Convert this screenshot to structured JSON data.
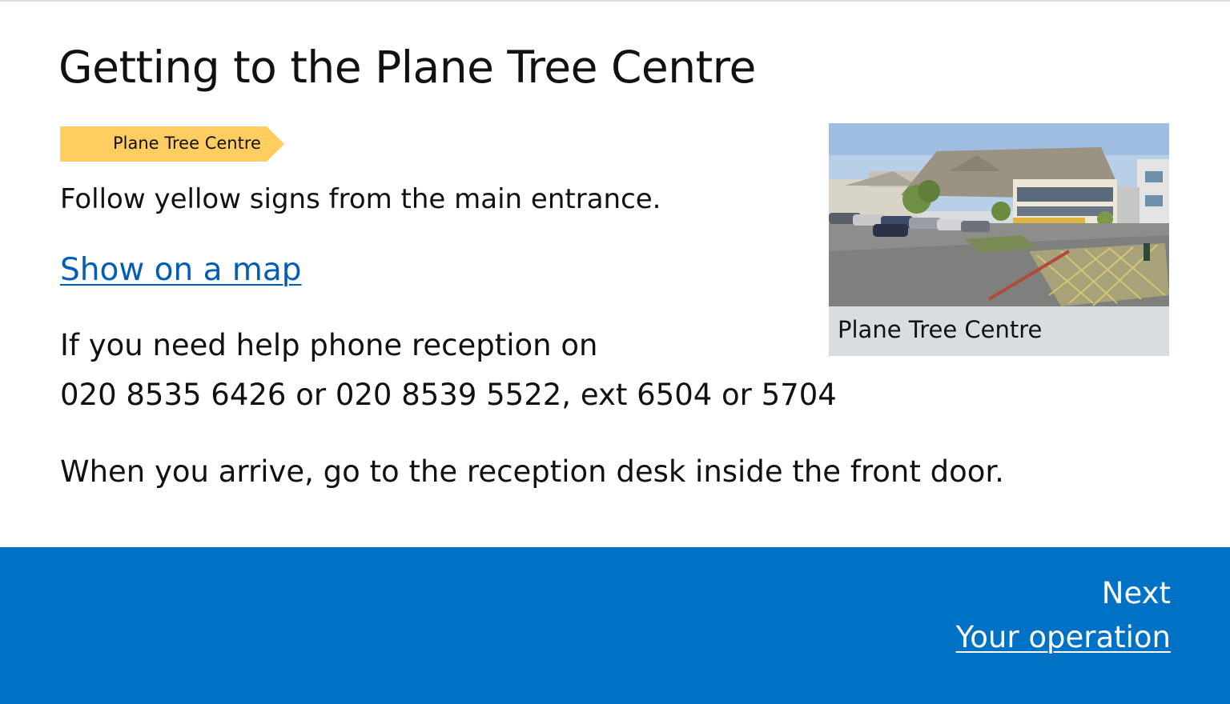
{
  "page": {
    "title": "Getting to the Plane Tree Centre"
  },
  "sign": {
    "label": "Plane Tree Centre",
    "color": "#ffcd60"
  },
  "directions": {
    "follow_text": "Follow yellow signs from the main entrance.",
    "map_link": "Show on a map",
    "help_line1": "If you need help phone reception on",
    "help_line2": "020 8535 6426 or 020 8539 5522, ext 6504 or 5704",
    "arrive_text": "When you arrive, go to the reception desk inside the front door."
  },
  "figure": {
    "caption": "Plane Tree Centre"
  },
  "footer": {
    "next_label": "Next",
    "next_link": "Your operation",
    "background": "#0072c6"
  },
  "colors": {
    "link": "#005eb8",
    "text": "#111111",
    "caption_background": "#d8dde0"
  }
}
